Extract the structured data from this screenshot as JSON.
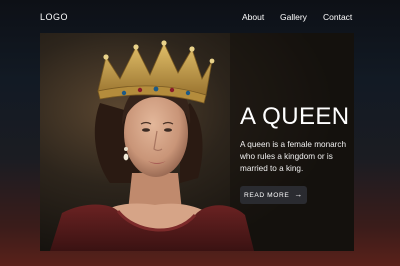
{
  "header": {
    "logo": "LOGO",
    "nav": [
      {
        "label": "About"
      },
      {
        "label": "Gallery"
      },
      {
        "label": "Contact"
      }
    ]
  },
  "hero": {
    "title": "A QUEEN",
    "description": "A queen is a female monarch who rules a kingdom or is married to a king.",
    "button_label": "READ MORE",
    "button_icon": "arrow-right-icon"
  },
  "colors": {
    "page_top": "#0d1016",
    "page_bottom": "#5a211a",
    "button_bg": "#2a2b30",
    "crown_gold": "#c9a24a",
    "dress": "#5b1e1e"
  }
}
